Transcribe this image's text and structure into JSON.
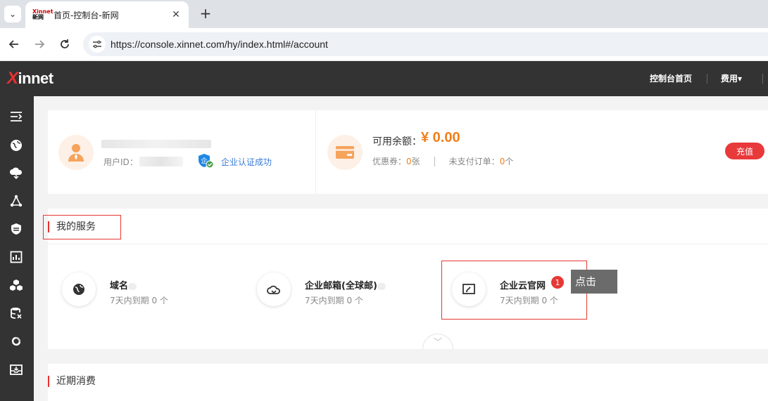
{
  "browser": {
    "tab_title": "首页-控制台-新网",
    "favicon_text_top": "Xinnet",
    "favicon_text_bottom": "新网",
    "url": "https://console.xinnet.com/hy/index.html#/account",
    "new_tab_glyph": "+",
    "close_glyph": "✕"
  },
  "header": {
    "logo_x": "X",
    "logo_rest": "innet",
    "nav_home": "控制台首页",
    "nav_fee": "费用▾"
  },
  "sidebar": {
    "icons": [
      "collapse-menu-icon",
      "globe-icon",
      "cloud-upload-icon",
      "network-icon",
      "shield-icon",
      "monitor-chart-icon",
      "cubes-icon",
      "database-icon",
      "link-icon",
      "inbox-icon"
    ]
  },
  "account": {
    "userid_label": "用户ID：",
    "verify_text": "企业认证成功",
    "verify_badge": "企",
    "balance_label": "可用余额：",
    "balance_value": "¥ 0.00",
    "coupon_label": "优惠券：",
    "coupon_value": "0",
    "coupon_unit": "张",
    "unpaid_label": "未支付订单：",
    "unpaid_value": "0",
    "unpaid_unit": "个",
    "recharge_label": "充值"
  },
  "services": {
    "title": "我的服务",
    "items": [
      {
        "name": "域名",
        "sub": "7天内到期 0 个",
        "icon": "globe-icon"
      },
      {
        "name": "企业邮箱(全球邮)",
        "sub": "7天内到期 0 个",
        "icon": "cloud-mail-icon"
      },
      {
        "name": "企业云官网",
        "sub": "7天内到期 0 个",
        "icon": "website-edit-icon"
      }
    ],
    "expand_glyph": "﹀"
  },
  "recent": {
    "title": "近期消费"
  },
  "annotation": {
    "badge": "1",
    "label": "点击",
    "colors": {
      "box": "#e53935",
      "label_bg": "#6b6b6b"
    }
  },
  "colors": {
    "header_bg": "#333333",
    "accent_red": "#e8302f",
    "orange": "#f0801a",
    "link_blue": "#3a7bd5"
  }
}
